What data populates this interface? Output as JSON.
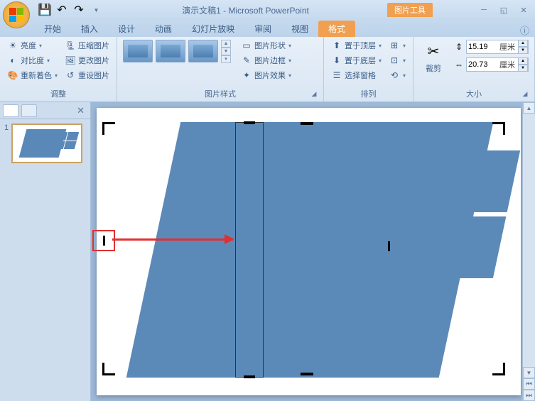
{
  "app": {
    "title": "演示文稿1 - Microsoft PowerPoint",
    "context_tab": "图片工具"
  },
  "tabs": {
    "home": "开始",
    "insert": "插入",
    "design": "设计",
    "animation": "动画",
    "slideshow": "幻灯片放映",
    "review": "审阅",
    "view": "视图",
    "format": "格式"
  },
  "ribbon": {
    "adjust": {
      "label": "调整",
      "brightness": "亮度",
      "contrast": "对比度",
      "recolor": "重新着色",
      "compress": "压缩图片",
      "change": "更改图片",
      "reset": "重设图片"
    },
    "styles": {
      "label": "图片样式",
      "shape": "图片形状",
      "border": "图片边框",
      "effects": "图片效果"
    },
    "arrange": {
      "label": "排列",
      "front": "置于顶层",
      "back": "置于底层",
      "selection": "选择窗格"
    },
    "size": {
      "label": "大小",
      "crop": "裁剪",
      "height_value": "15.19",
      "width_value": "20.73",
      "unit": "厘米"
    }
  },
  "panel": {
    "slide_num": "1"
  }
}
